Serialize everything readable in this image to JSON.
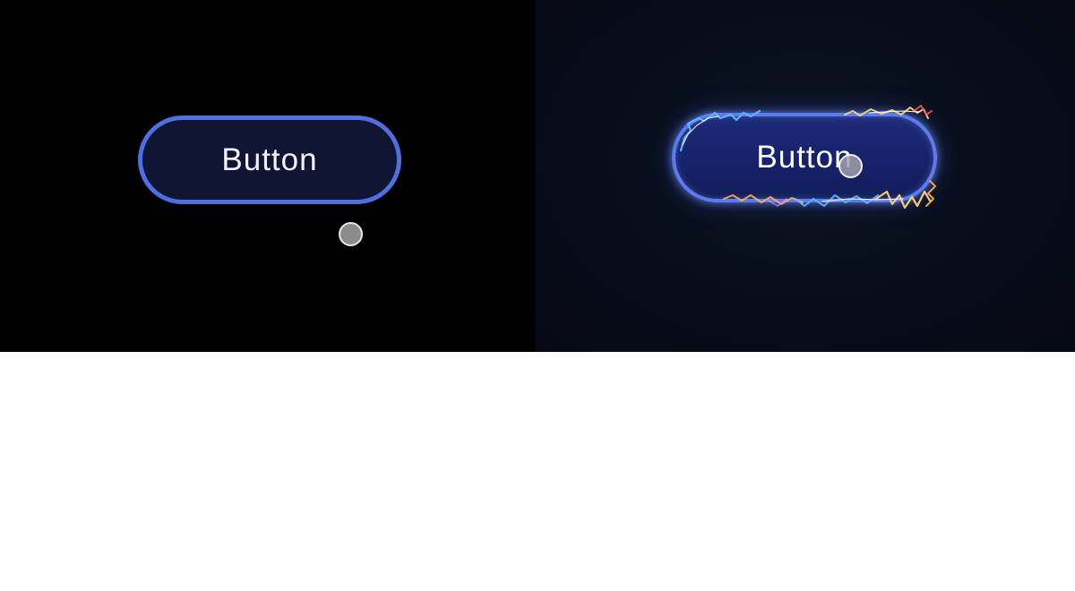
{
  "panels": [
    {
      "state": "idle",
      "button": {
        "label": "Button"
      },
      "cursor": {
        "icon": "cursor-dot-icon"
      }
    },
    {
      "state": "hover",
      "button": {
        "label": "Button"
      },
      "cursor": {
        "icon": "cursor-dot-icon"
      },
      "effect": "electric-spark-border"
    }
  ],
  "colors": {
    "left_background": "#000000",
    "right_background": "#070d19",
    "button_border": "#4f6fe0",
    "button_fill_idle": "#101534",
    "button_fill_hover": "#1c2a78",
    "spark_blue": "#5fb8ff",
    "spark_orange": "#ffb14a",
    "spark_white": "#ffffff"
  }
}
